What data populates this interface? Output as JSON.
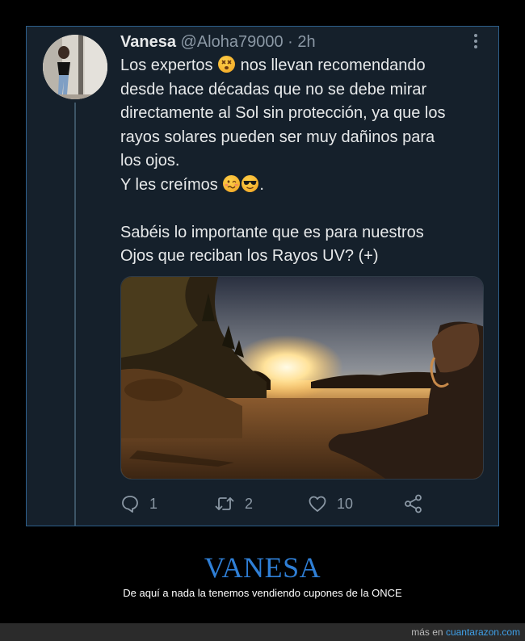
{
  "tweet": {
    "author_name": "Vanesa",
    "author_handle": "@Aloha79000",
    "separator": "·",
    "time": "2h",
    "text_lines": [
      {
        "before": "Los expertos ",
        "emoji": "dizzy-face-emoji",
        "after": " nos llevan recomendando"
      },
      "desde hace décadas que no se debe mirar",
      "directamente al Sol sin protección, ya que los",
      "rayos solares pueden ser muy dañinos para",
      "los ojos.",
      {
        "before": "Y les creímos ",
        "emojis": [
          "woozy-face-emoji",
          "sunglasses-face-emoji"
        ],
        "after": "."
      },
      "Sabéis lo importante que es para nuestros",
      "Ojos que reciban los Rayos UV? (+)"
    ],
    "image": "sunset-lake-photo",
    "actions": {
      "reply_count": "1",
      "retweet_count": "2",
      "like_count": "10"
    },
    "icons": {
      "more": "more-vertical-icon",
      "reply": "comment-icon",
      "retweet": "retweet-icon",
      "like": "heart-icon",
      "share": "share-icon"
    }
  },
  "caption": {
    "title": "VANESA",
    "subtitle": "De aquí a nada la tenemos vendiendo cupones de la ONCE"
  },
  "footer": {
    "prefix": "más en ",
    "link": "cuantarazon.com"
  },
  "colors": {
    "background": "#000000",
    "card": "#15202b",
    "card_border": "#2d5f8a",
    "text": "#e7e9ea",
    "muted": "#8b98a5",
    "title_blue": "#2f7fd6",
    "link_blue": "#3fa0e8"
  }
}
